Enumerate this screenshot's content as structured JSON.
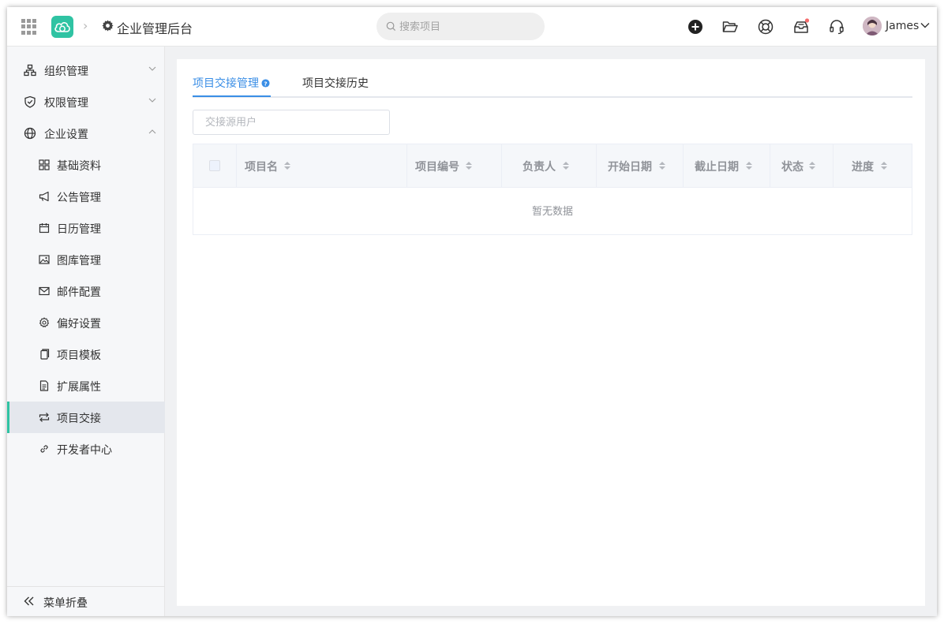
{
  "header": {
    "title": "企业管理后台",
    "search_placeholder": "搜索项目",
    "user_name": "James",
    "icons": [
      "apps-grid-icon",
      "gear-icon",
      "add-circle-icon",
      "folder-open-icon",
      "lifebuoy-icon",
      "inbox-icon",
      "headset-icon"
    ],
    "notification_dot_color": "#f56c6c"
  },
  "sidebar": {
    "groups": [
      {
        "label": "组织管理",
        "icon": "org-icon",
        "expanded": false
      },
      {
        "label": "权限管理",
        "icon": "shield-icon",
        "expanded": false
      },
      {
        "label": "企业设置",
        "icon": "globe-icon",
        "expanded": true
      }
    ],
    "sub_items": [
      {
        "label": "基础资料",
        "icon": "grid-icon"
      },
      {
        "label": "公告管理",
        "icon": "megaphone-icon"
      },
      {
        "label": "日历管理",
        "icon": "calendar-icon"
      },
      {
        "label": "图库管理",
        "icon": "image-icon"
      },
      {
        "label": "邮件配置",
        "icon": "mail-icon"
      },
      {
        "label": "偏好设置",
        "icon": "settings-icon"
      },
      {
        "label": "项目模板",
        "icon": "copy-icon"
      },
      {
        "label": "扩展属性",
        "icon": "document-icon"
      },
      {
        "label": "项目交接",
        "icon": "swap-icon",
        "active": true
      },
      {
        "label": "开发者中心",
        "icon": "link-icon"
      }
    ],
    "collapse_label": "菜单折叠",
    "accent_color": "#2fc3a3"
  },
  "main": {
    "tabs": [
      {
        "label": "项目交接管理",
        "active": true
      },
      {
        "label": "项目交接历史",
        "active": false
      }
    ],
    "filter_placeholder": "交接源用户",
    "table": {
      "columns": [
        "项目名",
        "项目编号",
        "负责人",
        "开始日期",
        "截止日期",
        "状态",
        "进度"
      ],
      "empty_text": "暂无数据"
    },
    "accent_color": "#3a8ee6"
  }
}
